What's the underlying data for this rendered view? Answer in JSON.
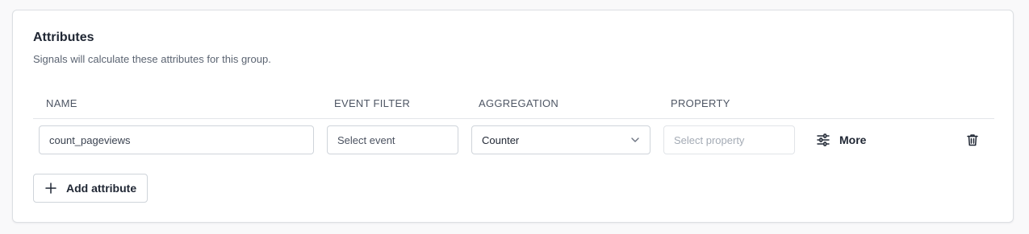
{
  "section": {
    "title": "Attributes",
    "subtitle": "Signals will calculate these attributes for this group."
  },
  "columns": [
    "NAME",
    "EVENT FILTER",
    "AGGREGATION",
    "PROPERTY"
  ],
  "row": {
    "name_value": "count_pageviews",
    "event_placeholder": "Select event",
    "aggregation_value": "Counter",
    "property_placeholder": "Select property",
    "more_label": "More"
  },
  "actions": {
    "add_label": "Add attribute"
  },
  "icons": [
    "sliders-icon",
    "chevron-down-icon",
    "trash-icon",
    "plus-icon"
  ]
}
